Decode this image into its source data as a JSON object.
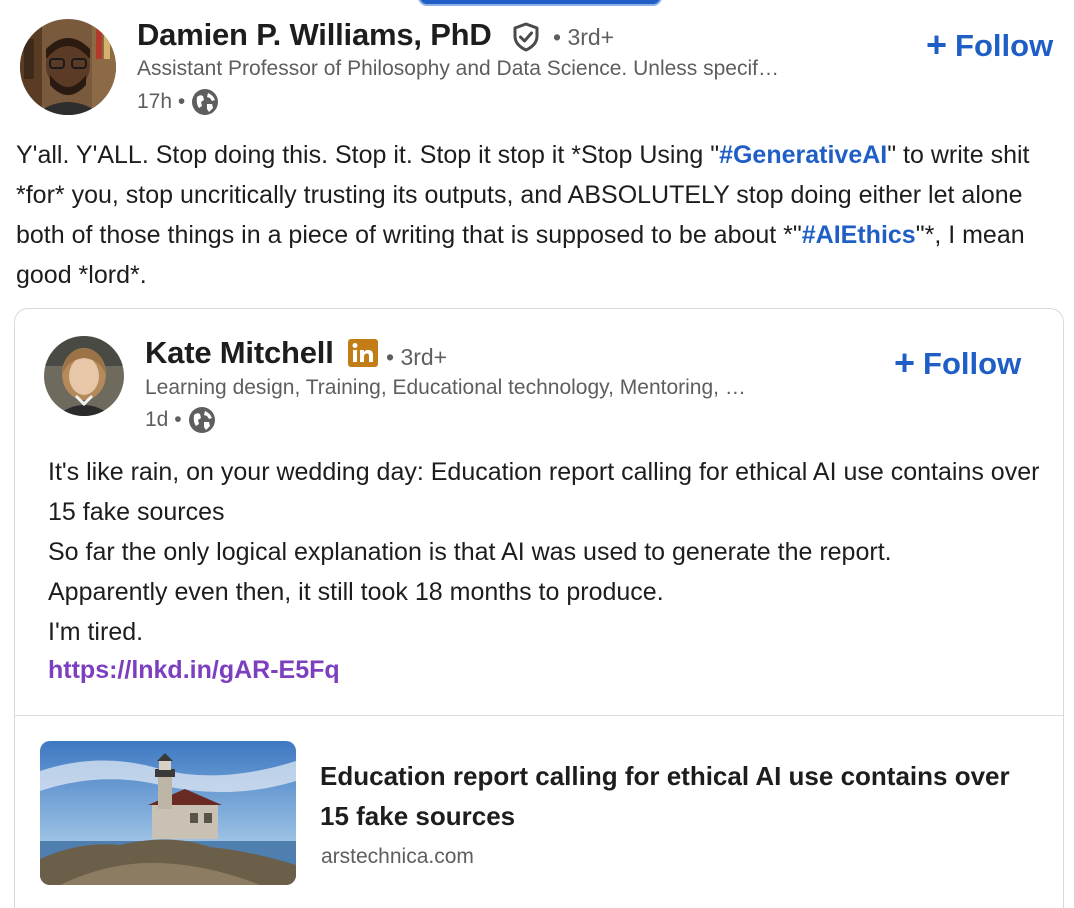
{
  "author": {
    "name": "Damien P. Williams, PhD",
    "degree": "• 3rd+",
    "headline": "Assistant Professor of Philosophy and Data Science. Unless specif…",
    "time": "17h •",
    "follow_label": "Follow"
  },
  "post": {
    "text_1": "Y'all. Y'ALL. Stop doing this. Stop it. Stop it stop it *Stop Using \"",
    "hashtag_1": "#GenerativeAI",
    "text_2": "\" to write shit *for* you, stop uncritically trusting its outputs, and ABSOLUTELY stop doing either let alone both of those things in a piece of writing that is supposed to be about *\"",
    "hashtag_2": "#AIEthics",
    "text_3": "\"*, I mean good *lord*."
  },
  "quoted": {
    "name": "Kate Mitchell",
    "degree": "• 3rd+",
    "headline": "Learning design, Training, Educational technology, Mentoring, …",
    "time": "1d •",
    "follow_label": "Follow",
    "lines": [
      "It's like rain, on your wedding day: Education report calling for ethical AI use contains over 15 fake sources",
      "So far the only logical explanation is that AI was used to generate the report.",
      "Apparently even then, it still took 18 months to produce.",
      "I'm tired."
    ],
    "link": "https://lnkd.in/gAR-E5Fq",
    "article": {
      "title": "Education report calling for ethical AI use contains over 15 fake sources",
      "source": "arstechnica.com"
    }
  },
  "icons": {
    "verified": "shield-check-icon",
    "globe": "globe-icon",
    "linkedin_badge": "linkedin-in-icon",
    "plus": "plus-icon"
  },
  "colors": {
    "link_blue": "#1f5fc5",
    "link_purple": "#7b3fbf",
    "linkedin_gold": "#c37d16"
  }
}
